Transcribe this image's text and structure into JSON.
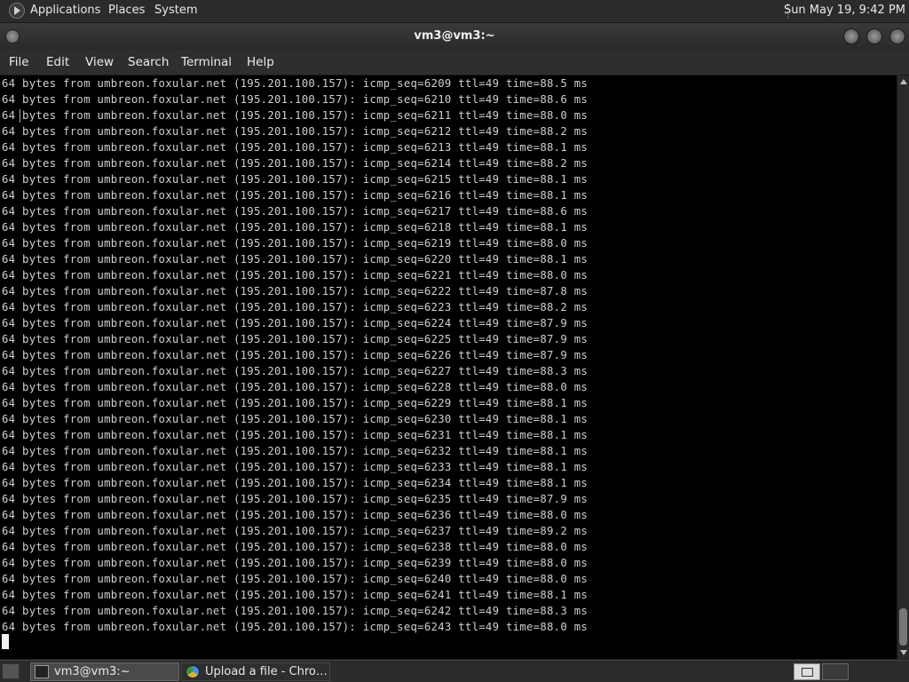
{
  "panel": {
    "menus": [
      "Applications",
      "Places",
      "System"
    ],
    "clock": "Sun May 19,  9:42 PM",
    "app_icon": "gnome-foot-icon"
  },
  "window": {
    "title": "vm3@vm3:~"
  },
  "menubar": {
    "items": [
      "File",
      "Edit",
      "View",
      "Search",
      "Terminal",
      "Help"
    ]
  },
  "terminal": {
    "lines": [
      "64 bytes from umbreon.foxular.net (195.201.100.157): icmp_seq=6209 ttl=49 time=88.5 ms",
      "64 bytes from umbreon.foxular.net (195.201.100.157): icmp_seq=6210 ttl=49 time=88.6 ms",
      "64 bytes from umbreon.foxular.net (195.201.100.157): icmp_seq=6211 ttl=49 time=88.0 ms",
      "64 bytes from umbreon.foxular.net (195.201.100.157): icmp_seq=6212 ttl=49 time=88.2 ms",
      "64 bytes from umbreon.foxular.net (195.201.100.157): icmp_seq=6213 ttl=49 time=88.1 ms",
      "64 bytes from umbreon.foxular.net (195.201.100.157): icmp_seq=6214 ttl=49 time=88.2 ms",
      "64 bytes from umbreon.foxular.net (195.201.100.157): icmp_seq=6215 ttl=49 time=88.1 ms",
      "64 bytes from umbreon.foxular.net (195.201.100.157): icmp_seq=6216 ttl=49 time=88.1 ms",
      "64 bytes from umbreon.foxular.net (195.201.100.157): icmp_seq=6217 ttl=49 time=88.6 ms",
      "64 bytes from umbreon.foxular.net (195.201.100.157): icmp_seq=6218 ttl=49 time=88.1 ms",
      "64 bytes from umbreon.foxular.net (195.201.100.157): icmp_seq=6219 ttl=49 time=88.0 ms",
      "64 bytes from umbreon.foxular.net (195.201.100.157): icmp_seq=6220 ttl=49 time=88.1 ms",
      "64 bytes from umbreon.foxular.net (195.201.100.157): icmp_seq=6221 ttl=49 time=88.0 ms",
      "64 bytes from umbreon.foxular.net (195.201.100.157): icmp_seq=6222 ttl=49 time=87.8 ms",
      "64 bytes from umbreon.foxular.net (195.201.100.157): icmp_seq=6223 ttl=49 time=88.2 ms",
      "64 bytes from umbreon.foxular.net (195.201.100.157): icmp_seq=6224 ttl=49 time=87.9 ms",
      "64 bytes from umbreon.foxular.net (195.201.100.157): icmp_seq=6225 ttl=49 time=87.9 ms",
      "64 bytes from umbreon.foxular.net (195.201.100.157): icmp_seq=6226 ttl=49 time=87.9 ms",
      "64 bytes from umbreon.foxular.net (195.201.100.157): icmp_seq=6227 ttl=49 time=88.3 ms",
      "64 bytes from umbreon.foxular.net (195.201.100.157): icmp_seq=6228 ttl=49 time=88.0 ms",
      "64 bytes from umbreon.foxular.net (195.201.100.157): icmp_seq=6229 ttl=49 time=88.1 ms",
      "64 bytes from umbreon.foxular.net (195.201.100.157): icmp_seq=6230 ttl=49 time=88.1 ms",
      "64 bytes from umbreon.foxular.net (195.201.100.157): icmp_seq=6231 ttl=49 time=88.1 ms",
      "64 bytes from umbreon.foxular.net (195.201.100.157): icmp_seq=6232 ttl=49 time=88.1 ms",
      "64 bytes from umbreon.foxular.net (195.201.100.157): icmp_seq=6233 ttl=49 time=88.1 ms",
      "64 bytes from umbreon.foxular.net (195.201.100.157): icmp_seq=6234 ttl=49 time=88.1 ms",
      "64 bytes from umbreon.foxular.net (195.201.100.157): icmp_seq=6235 ttl=49 time=87.9 ms",
      "64 bytes from umbreon.foxular.net (195.201.100.157): icmp_seq=6236 ttl=49 time=88.0 ms",
      "64 bytes from umbreon.foxular.net (195.201.100.157): icmp_seq=6237 ttl=49 time=89.2 ms",
      "64 bytes from umbreon.foxular.net (195.201.100.157): icmp_seq=6238 ttl=49 time=88.0 ms",
      "64 bytes from umbreon.foxular.net (195.201.100.157): icmp_seq=6239 ttl=49 time=88.0 ms",
      "64 bytes from umbreon.foxular.net (195.201.100.157): icmp_seq=6240 ttl=49 time=88.0 ms",
      "64 bytes from umbreon.foxular.net (195.201.100.157): icmp_seq=6241 ttl=49 time=88.1 ms",
      "64 bytes from umbreon.foxular.net (195.201.100.157): icmp_seq=6242 ttl=49 time=88.3 ms",
      "64 bytes from umbreon.foxular.net (195.201.100.157): icmp_seq=6243 ttl=49 time=88.0 ms"
    ]
  },
  "taskbar": {
    "tasks": [
      {
        "label": "vm3@vm3:~",
        "icon": "terminal-icon"
      },
      {
        "label": "Upload a file - Chro…",
        "icon": "chrome-icon"
      }
    ]
  },
  "colors": {
    "terminal_bg": "#000000",
    "terminal_fg": "#cfcfcf",
    "panel_bg": "#2b2b2b"
  }
}
